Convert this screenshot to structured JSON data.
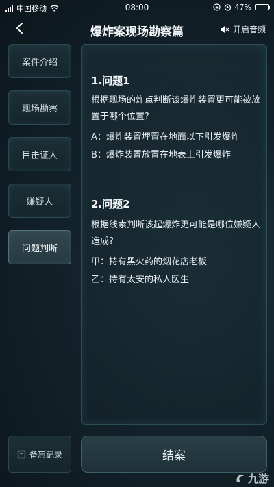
{
  "status_bar": {
    "carrier": "中国移动",
    "time": "08:00",
    "battery": "47%",
    "battery_level": 0.47
  },
  "header": {
    "title": "爆炸案现场勘察篇",
    "audio_label": "开启音频"
  },
  "sidebar": {
    "items": [
      {
        "label": "案件介绍"
      },
      {
        "label": "现场勘察"
      },
      {
        "label": "目击证人"
      },
      {
        "label": "嫌疑人"
      },
      {
        "label": "问题判断"
      }
    ],
    "active_index": 4
  },
  "question1": {
    "heading": "1.问题1",
    "text": "根据现场的炸点判断该爆炸装置更可能被放置于哪个位置?",
    "option_a": "A：爆炸装置埋置在地面以下引发爆炸",
    "option_b": "B：爆炸装置放置在地表上引发爆炸"
  },
  "question2": {
    "heading": "2.问题2",
    "text": "根据线索判断该起爆炸更可能是哪位嫌疑人造成?",
    "option_a": "甲：持有黑火药的烟花店老板",
    "option_b": "乙：持有太安的私人医生"
  },
  "bottom": {
    "memo_label": "备忘记录",
    "close_case_label": "结案"
  },
  "watermark": {
    "text": "九游"
  },
  "colors": {
    "background": "#13222a",
    "panel_border": "#2f4d57",
    "active_tab": "#33464d"
  }
}
